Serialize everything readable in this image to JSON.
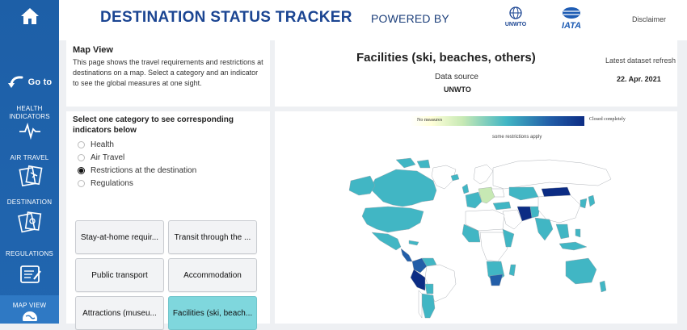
{
  "header": {
    "title": "DESTINATION STATUS TRACKER",
    "powered_by": "POWERED BY",
    "logo_unwto": "UNWTO",
    "logo_iata": "IATA",
    "disclaimer": "Disclaimer"
  },
  "sidebar": {
    "goto": "Go to",
    "items": [
      {
        "label": "HEALTH INDICATORS",
        "icon": "heartbeat-icon"
      },
      {
        "label": "AIR TRAVEL",
        "icon": "passport-icon"
      },
      {
        "label": "DESTINATION",
        "icon": "destination-passport-icon"
      },
      {
        "label": "REGULATIONS",
        "icon": "document-edit-icon"
      },
      {
        "label": "MAP VIEW",
        "icon": "globe-icon"
      }
    ]
  },
  "map_view": {
    "heading": "Map View",
    "description": "This page shows the travel requirements and restrictions at destinations on a map. Select a category and an indicator to see the global measures at one sight."
  },
  "category": {
    "prompt": "Select one category to see corresponding indicators below",
    "options": [
      "Health",
      "Air Travel",
      "Restrictions at the destination",
      "Regulations"
    ],
    "selected": "Restrictions at the destination"
  },
  "indicators": [
    "Stay-at-home requir...",
    "Transit through the ...",
    "Public transport",
    "Accommodation",
    "Attractions (museu...",
    "Facilities (ski, beach..."
  ],
  "selected_indicator": "Facilities (ski, beach...",
  "info": {
    "facility_title": "Facilities (ski, beaches, others)",
    "data_source_label": "Data source",
    "data_source_value": "UNWTO",
    "refresh_label": "Latest dataset refresh",
    "refresh_date": "22. Apr. 2021"
  },
  "legend": {
    "low": "No measures",
    "high": "Closed completely",
    "middle": "some restrictions apply"
  },
  "colors": {
    "sidebar": "#1d5fa7",
    "title": "#1b4592",
    "selected_chip": "#7fd7dd",
    "scale_low": "#ffffcc",
    "scale_mid": "#41b6c4",
    "scale_high": "#0c2c84"
  }
}
